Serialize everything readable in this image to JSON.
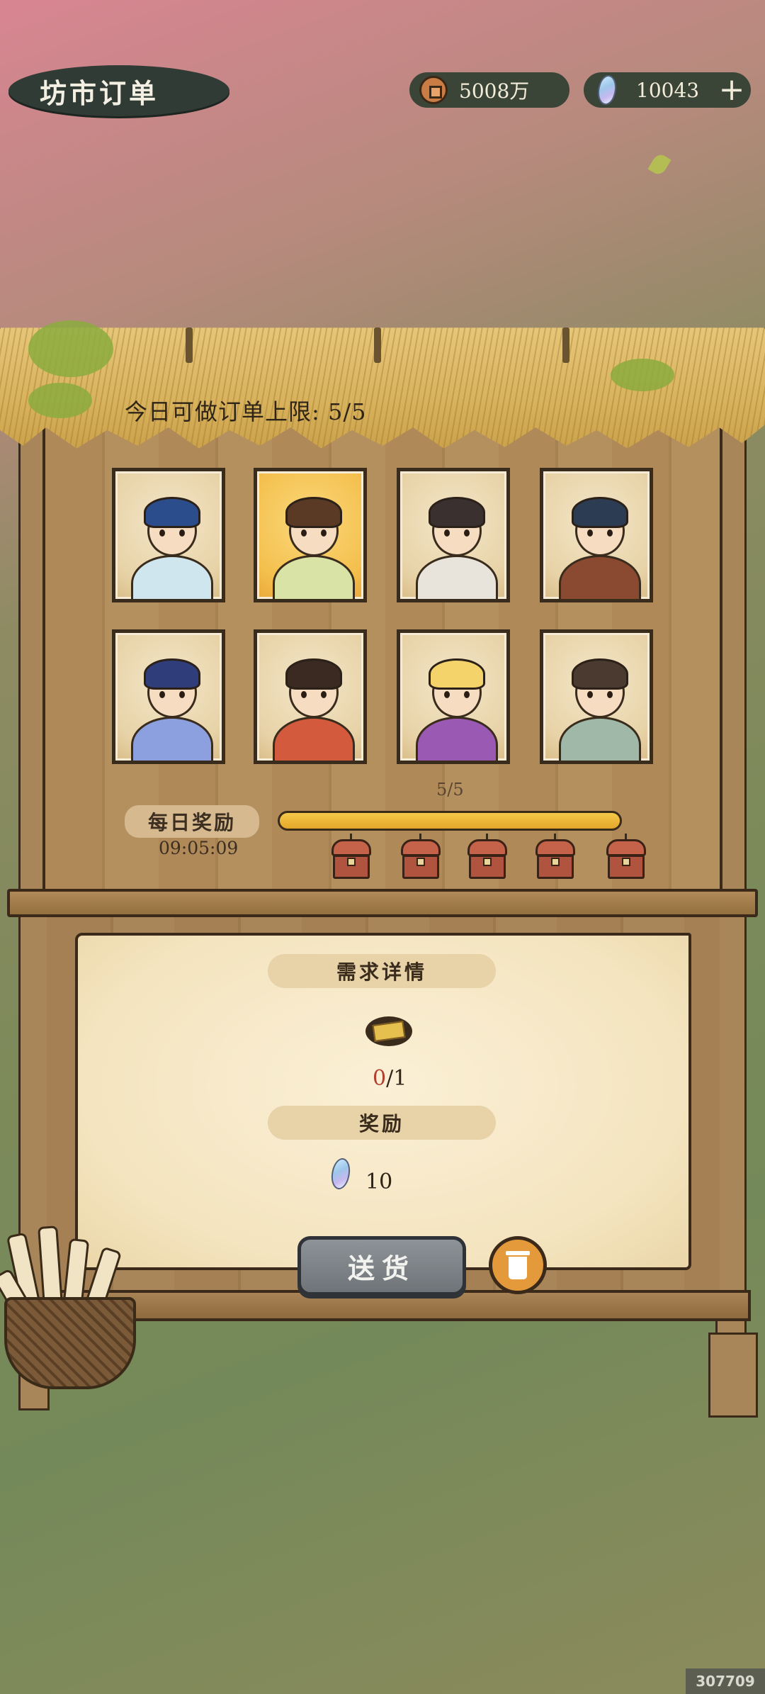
{
  "header": {
    "title": "坊市订单",
    "coins": "5008万",
    "gems": "10043",
    "plus_symbol": "+"
  },
  "stall": {
    "order_limit_label": "今日可做订单上限: 5/5"
  },
  "portraits": [
    {
      "name": "dragon",
      "hair": "#2b4d8c",
      "robe": "#cfe6ee",
      "selected": false
    },
    {
      "name": "girl",
      "hair": "#5a3a24",
      "robe": "#d9e3a6",
      "selected": true
    },
    {
      "name": "elder",
      "hair": "#3a3030",
      "robe": "#e8e4dc",
      "selected": false
    },
    {
      "name": "boy",
      "hair": "#2c3c52",
      "robe": "#8a4a32",
      "selected": false
    },
    {
      "name": "fox-lady",
      "hair": "#2f3d7a",
      "robe": "#8ca0e0",
      "selected": false
    },
    {
      "name": "merchant",
      "hair": "#3a2a22",
      "robe": "#d45a3e",
      "selected": false
    },
    {
      "name": "dancer",
      "hair": "#f3d36a",
      "robe": "#9a5ab4",
      "selected": false
    },
    {
      "name": "cook",
      "hair": "#4a3a30",
      "robe": "#9fb8a8",
      "selected": false
    }
  ],
  "daily_reward": {
    "label": "每日奖励",
    "timer": "09:05:09",
    "progress_text": "5/5",
    "progress_fraction": 1.0,
    "chest_count": 5
  },
  "order_detail": {
    "demand_title": "需求详情",
    "item_icon": "book-icon",
    "item_current": "0",
    "item_total": "/1",
    "reward_title": "奖励",
    "reward_icon": "gem-icon",
    "reward_amount": "10"
  },
  "actions": {
    "deliver_label": "送货",
    "discard_icon": "trash-icon"
  },
  "watermark": "307709"
}
